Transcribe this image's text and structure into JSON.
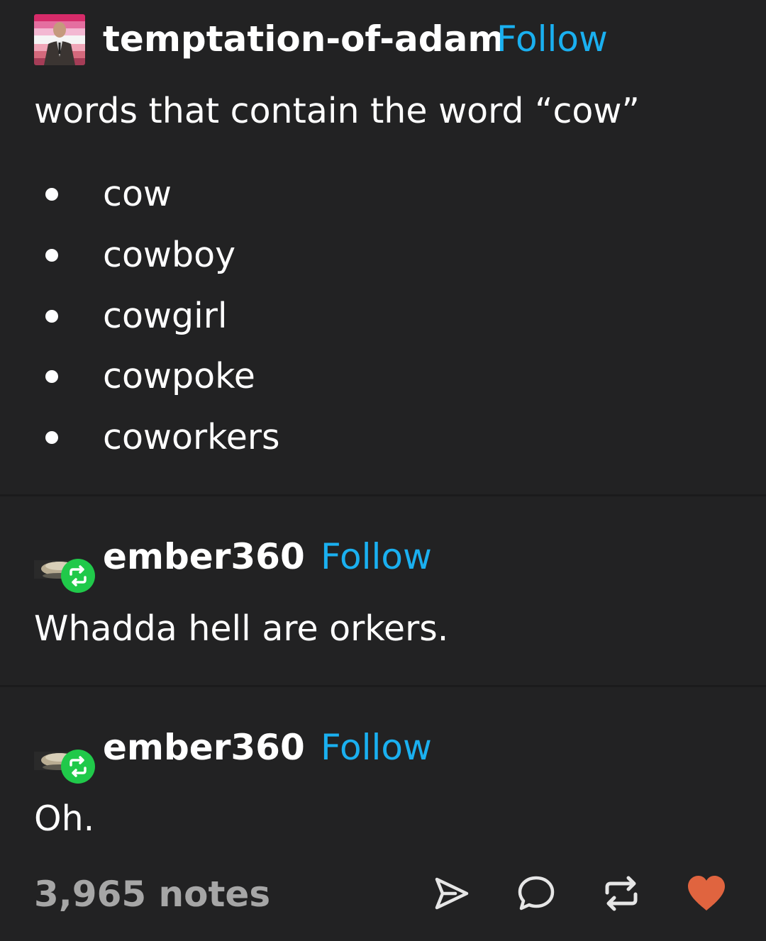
{
  "post": {
    "author": "temptation-of-adam",
    "follow_label": "Follow",
    "title": "words that contain the word “cow”",
    "list": [
      "cow",
      "cowboy",
      "cowgirl",
      "cowpoke",
      "coworkers"
    ]
  },
  "reblogs": [
    {
      "author": "ember360",
      "follow_label": "Follow",
      "text": "Whadda hell are orkers."
    },
    {
      "author": "ember360",
      "follow_label": "Follow",
      "text": "Oh."
    }
  ],
  "footer": {
    "notes": "3,965 notes",
    "actions": [
      "share-icon",
      "comment-icon",
      "reblog-icon",
      "like-icon"
    ]
  },
  "colors": {
    "background": "#222223",
    "follow": "#1ab0f0",
    "reblog_badge": "#20c94a",
    "like": "#e0643f",
    "notes": "#a6a6a6"
  }
}
